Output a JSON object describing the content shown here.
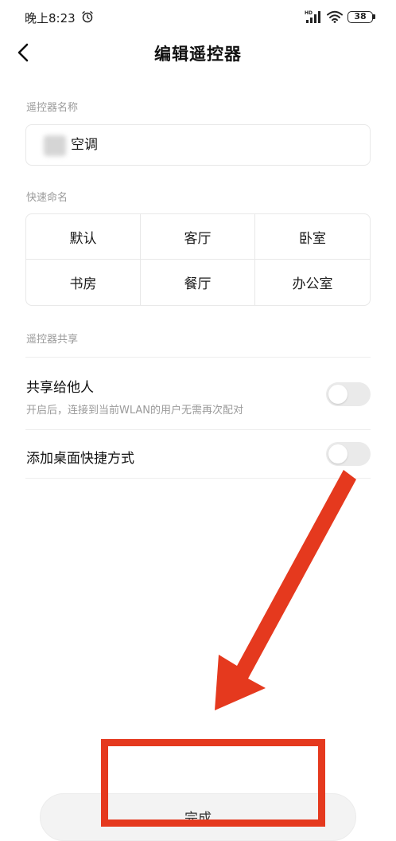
{
  "status_bar": {
    "time": "晚上8:23",
    "battery": "38",
    "icons": [
      "alarm-icon",
      "signal-icon",
      "wifi-icon",
      "battery-icon"
    ]
  },
  "header": {
    "title": "编辑遥控器",
    "back_icon": "chevron-left-icon"
  },
  "remote_name": {
    "label": "遥控器名称",
    "value": "空调"
  },
  "quick_name": {
    "label": "快速命名",
    "options": [
      "默认",
      "客厅",
      "卧室",
      "书房",
      "餐厅",
      "办公室"
    ]
  },
  "sharing": {
    "label": "遥控器共享",
    "share_title": "共享给他人",
    "share_desc": "开启后，连接到当前WLAN的用户无需再次配对",
    "share_enabled": false,
    "shortcut_title": "添加桌面快捷方式",
    "shortcut_enabled": false
  },
  "footer": {
    "done_label": "完成"
  },
  "annotation": {
    "color": "#e5391e"
  }
}
